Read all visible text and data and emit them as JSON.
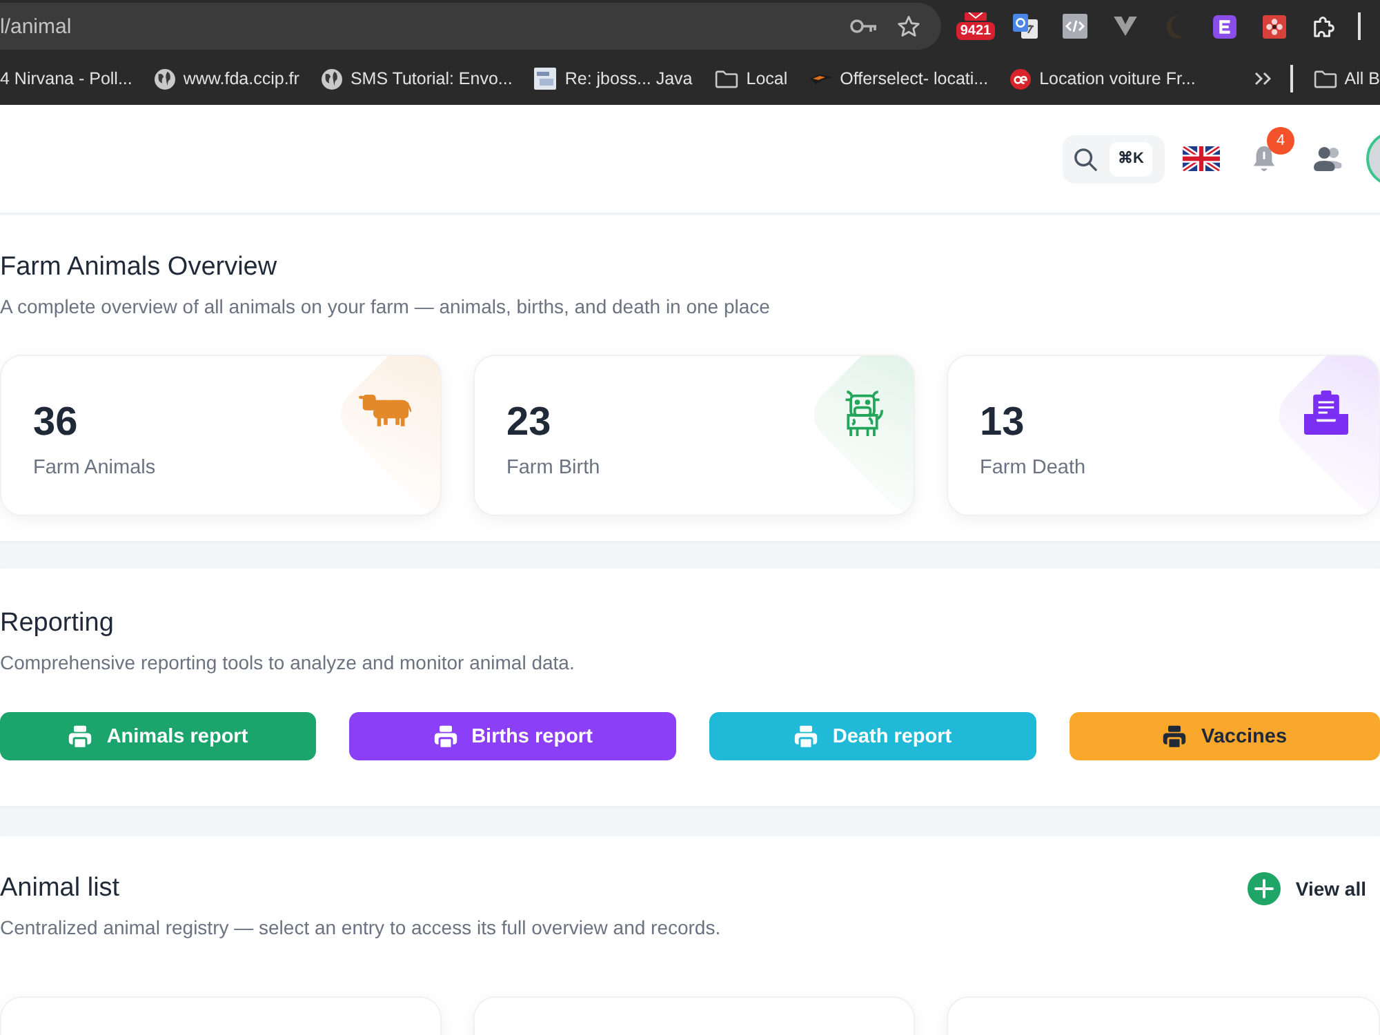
{
  "browser": {
    "address": "l/animal",
    "extension_badge": "9421",
    "bookmarks": [
      {
        "label": "4 Nirvana - Poll...",
        "kind": "none"
      },
      {
        "label": "www.fda.ccip.fr",
        "kind": "globe"
      },
      {
        "label": "SMS Tutorial: Envo...",
        "kind": "globe"
      },
      {
        "label": "Re: jboss... Java",
        "kind": "thumbnail"
      },
      {
        "label": "Local",
        "kind": "folder"
      },
      {
        "label": "Offerselect- locati...",
        "kind": "logo"
      },
      {
        "label": "Location voiture Fr...",
        "kind": "badge"
      }
    ],
    "other_bookmarks": {
      "label": "All B",
      "kind": "folder"
    }
  },
  "header": {
    "shortcut": "⌘K",
    "notification_count": "4"
  },
  "overview": {
    "title": "Farm Animals Overview",
    "subtitle": "A complete overview of all animals on your farm — animals, births, and death in one place",
    "stats": [
      {
        "value": "36",
        "label": "Farm Animals",
        "kind": "cow",
        "color": "#e3892a"
      },
      {
        "value": "23",
        "label": "Farm Birth",
        "kind": "calf",
        "color": "#23a55a"
      },
      {
        "value": "13",
        "label": "Farm Death",
        "kind": "clipboard",
        "color": "#7b2ff2"
      }
    ]
  },
  "reporting": {
    "title": "Reporting",
    "subtitle": "Comprehensive reporting tools to analyze and monitor animal data.",
    "buttons": [
      {
        "label": "Animals report",
        "color": "#1ba56d"
      },
      {
        "label": "Births report",
        "color": "#8b3ff7"
      },
      {
        "label": "Death report",
        "color": "#20b9d8"
      },
      {
        "label": "Vaccines",
        "color": "#f9a82b"
      }
    ]
  },
  "animal_list": {
    "title": "Animal list",
    "subtitle": "Centralized animal registry — select an entry to access its full overview and records.",
    "action": "View all"
  }
}
